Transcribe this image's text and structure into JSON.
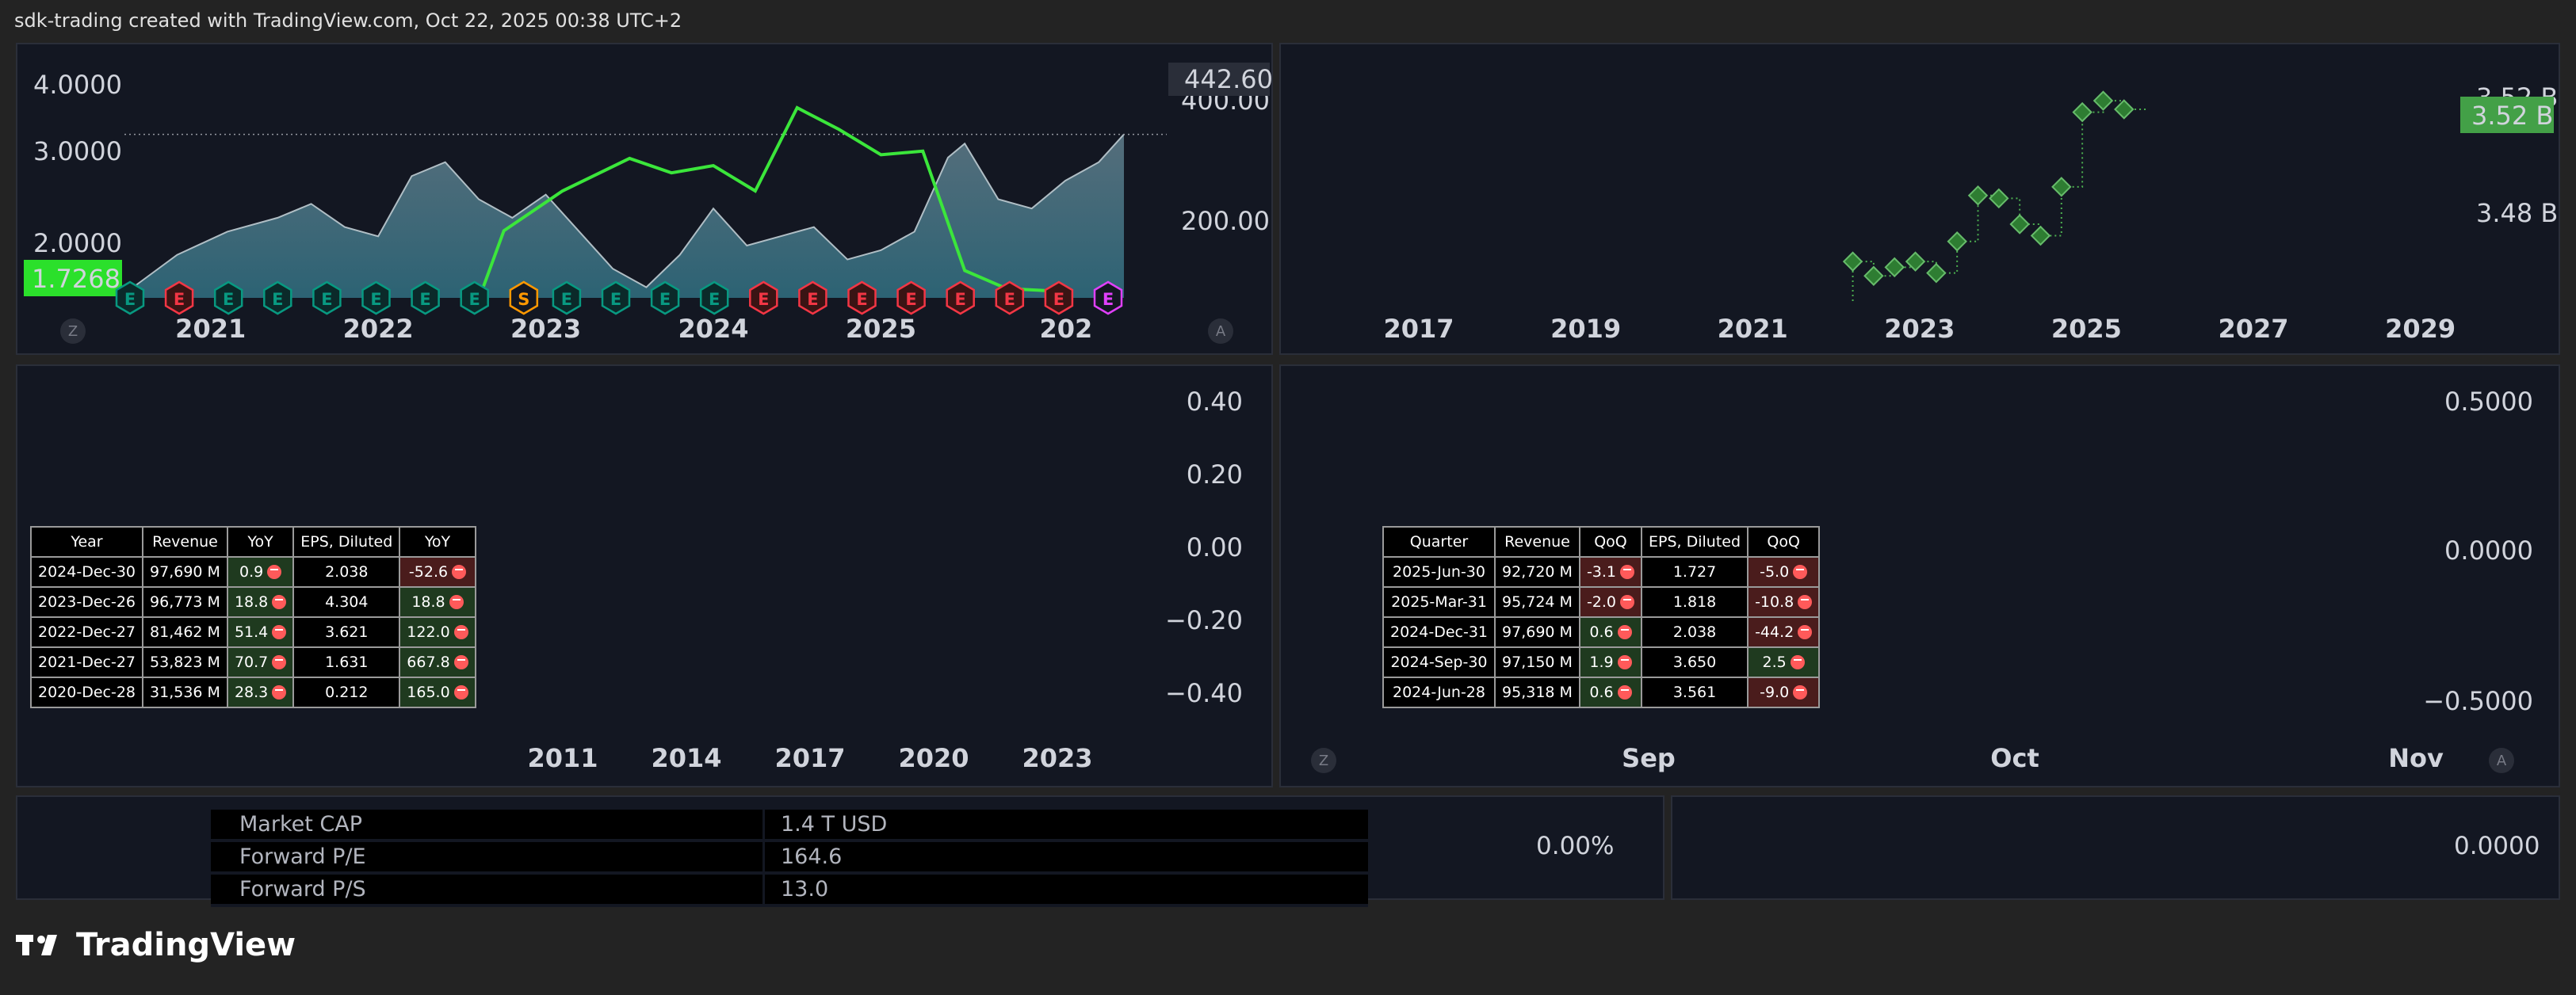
{
  "header": {
    "title": "sdk-trading created with TradingView.com, Oct 22, 2025 00:38 UTC+2"
  },
  "branding": {
    "logo_text": "TradingView"
  },
  "colors": {
    "background": "#232323",
    "panel": "#131722",
    "green_line": "#3be63b",
    "price_area": "#5b8fa8",
    "earnings_red": "#f23645",
    "earnings_teal": "#089981",
    "dividend_purple": "#e040fb"
  },
  "corner_buttons": {
    "z": "Z",
    "a": "A"
  },
  "chart_data": [
    {
      "name_id": "price-chart",
      "type": "area",
      "left_axis_ticks": [
        "4.0000",
        "3.0000",
        "2.0000"
      ],
      "right_axis_ticks": [
        "400.00",
        "200.00"
      ],
      "x_tick_labels": [
        "2021",
        "2022",
        "2023",
        "2024",
        "2025",
        "202"
      ],
      "last_price_label": "442.60",
      "left_value_label": "1.7268",
      "price_series": {
        "x": [
          2020.0,
          2020.3,
          2020.6,
          2020.9,
          2021.1,
          2021.3,
          2021.5,
          2021.7,
          2021.9,
          2022.1,
          2022.3,
          2022.5,
          2022.7,
          2022.9,
          2023.1,
          2023.3,
          2023.5,
          2023.7,
          2023.9,
          2024.1,
          2024.3,
          2024.5,
          2024.7,
          2024.9,
          2025.0,
          2025.2,
          2025.4,
          2025.6,
          2025.8,
          2025.95
        ],
        "values": [
          100,
          180,
          230,
          260,
          290,
          240,
          220,
          350,
          380,
          300,
          260,
          310,
          230,
          150,
          110,
          180,
          280,
          200,
          220,
          240,
          170,
          190,
          230,
          390,
          420,
          300,
          280,
          340,
          380,
          440
        ]
      },
      "green_series": {
        "x": [
          2022.1,
          2022.25,
          2022.6,
          2023.0,
          2023.25,
          2023.5,
          2023.75,
          2024.0,
          2024.25,
          2024.5,
          2024.75,
          2025.0,
          2025.25,
          2025.5
        ],
        "values": [
          1.6,
          2.55,
          3.1,
          3.55,
          3.35,
          3.45,
          3.1,
          4.25,
          3.95,
          3.6,
          3.65,
          2.0,
          1.75,
          1.72
        ]
      },
      "earnings_markers": [
        "E",
        "E",
        "E",
        "E",
        "E",
        "E",
        "E",
        "E",
        "S",
        "E",
        "E",
        "E",
        "E",
        "E",
        "E",
        "E",
        "E",
        "E",
        "E",
        "E",
        "E"
      ]
    },
    {
      "name_id": "shares-chart",
      "type": "scatter",
      "right_axis_ticks": [
        "3.52 B",
        "3.48 B"
      ],
      "last_value_label": "3.52 B",
      "x_tick_labels": [
        "2017",
        "2019",
        "2021",
        "2023",
        "2025",
        "2027",
        "2029"
      ],
      "x": [
        2022.2,
        2022.45,
        2022.7,
        2022.95,
        2023.2,
        2023.45,
        2023.7,
        2023.95,
        2024.2,
        2024.45,
        2024.7,
        2024.95,
        2025.2,
        2025.45
      ],
      "values": [
        3.466,
        3.461,
        3.464,
        3.466,
        3.462,
        3.473,
        3.489,
        3.488,
        3.479,
        3.475,
        3.492,
        3.518,
        3.522,
        3.519
      ],
      "ylim": [
        3.455,
        3.535
      ]
    },
    {
      "name_id": "annual-chart",
      "type": "table",
      "right_axis_ticks": [
        "0.40",
        "0.20",
        "0.00",
        "−0.20",
        "−0.40"
      ],
      "x_tick_labels": [
        "2011",
        "2014",
        "2017",
        "2020",
        "2023"
      ],
      "table": {
        "headers": [
          "Year",
          "Revenue",
          "YoY",
          "EPS, Diluted",
          "YoY"
        ],
        "rows": [
          {
            "period": "2024-Dec-30",
            "revenue": "97,690 M",
            "rev_change": "0.9",
            "eps": "2.038",
            "eps_change": "-52.6",
            "rev_pos": true,
            "eps_pos": false
          },
          {
            "period": "2023-Dec-26",
            "revenue": "96,773 M",
            "rev_change": "18.8",
            "eps": "4.304",
            "eps_change": "18.8",
            "rev_pos": true,
            "eps_pos": true
          },
          {
            "period": "2022-Dec-27",
            "revenue": "81,462 M",
            "rev_change": "51.4",
            "eps": "3.621",
            "eps_change": "122.0",
            "rev_pos": true,
            "eps_pos": true
          },
          {
            "period": "2021-Dec-27",
            "revenue": "53,823 M",
            "rev_change": "70.7",
            "eps": "1.631",
            "eps_change": "667.8",
            "rev_pos": true,
            "eps_pos": true
          },
          {
            "period": "2020-Dec-28",
            "revenue": "31,536 M",
            "rev_change": "28.3",
            "eps": "0.212",
            "eps_change": "165.0",
            "rev_pos": true,
            "eps_pos": true
          }
        ]
      }
    },
    {
      "name_id": "quarterly-chart",
      "type": "table",
      "right_axis_ticks": [
        "0.5000",
        "0.0000",
        "−0.5000"
      ],
      "x_tick_labels": [
        "Sep",
        "Oct",
        "Nov"
      ],
      "table": {
        "headers": [
          "Quarter",
          "Revenue",
          "QoQ",
          "EPS, Diluted",
          "QoQ"
        ],
        "rows": [
          {
            "period": "2025-Jun-30",
            "revenue": "92,720 M",
            "rev_change": "-3.1",
            "eps": "1.727",
            "eps_change": "-5.0",
            "rev_pos": false,
            "eps_pos": false
          },
          {
            "period": "2025-Mar-31",
            "revenue": "95,724 M",
            "rev_change": "-2.0",
            "eps": "1.818",
            "eps_change": "-10.8",
            "rev_pos": false,
            "eps_pos": false
          },
          {
            "period": "2024-Dec-31",
            "revenue": "97,690 M",
            "rev_change": "0.6",
            "eps": "2.038",
            "eps_change": "-44.2",
            "rev_pos": true,
            "eps_pos": false
          },
          {
            "period": "2024-Sep-30",
            "revenue": "97,150 M",
            "rev_change": "1.9",
            "eps": "3.650",
            "eps_change": "2.5",
            "rev_pos": true,
            "eps_pos": true
          },
          {
            "period": "2024-Jun-28",
            "revenue": "95,318 M",
            "rev_change": "0.6",
            "eps": "3.561",
            "eps_change": "-9.0",
            "rev_pos": true,
            "eps_pos": false
          }
        ]
      }
    }
  ],
  "stats": {
    "rows": [
      {
        "label": "Market CAP",
        "value": "1.4 T USD"
      },
      {
        "label": "Forward P/E",
        "value": "164.6"
      },
      {
        "label": "Forward P/S",
        "value": "13.0"
      }
    ],
    "pct_label": "0.00%",
    "right_value": "0.0000"
  }
}
